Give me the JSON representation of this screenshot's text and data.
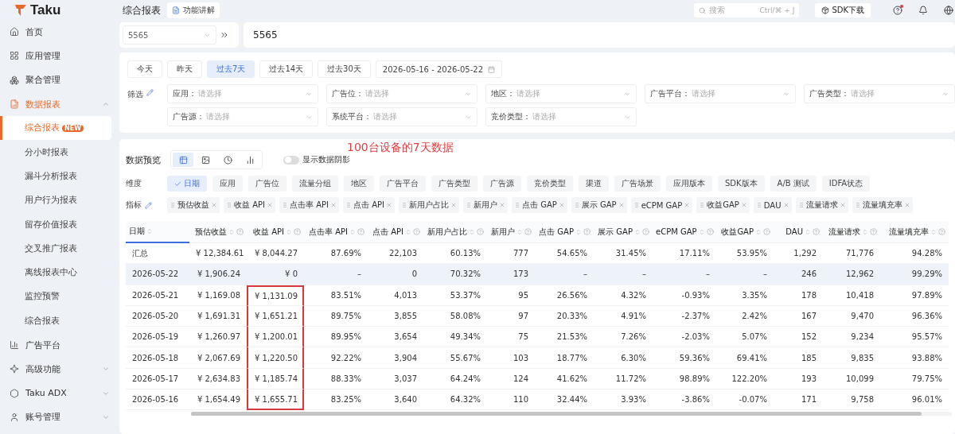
{
  "sidebar": {
    "logo": "Taku",
    "items": [
      {
        "label": "首页",
        "kind": "link",
        "selected": false
      },
      {
        "label": "应用管理",
        "kind": "link",
        "selected": false
      },
      {
        "label": "聚合管理",
        "kind": "link",
        "selected": false
      },
      {
        "label": "数据报表",
        "kind": "group",
        "selected": true,
        "expanded": true,
        "children": [
          {
            "label": "综合报表",
            "badge": "NEW",
            "selected": true
          },
          {
            "label": "分小时报表",
            "selected": false
          },
          {
            "label": "漏斗分析报表",
            "selected": false
          },
          {
            "label": "用户行为报表",
            "selected": false
          },
          {
            "label": "留存价值报表",
            "selected": false
          },
          {
            "label": "交叉推广报表",
            "selected": false
          },
          {
            "label": "离线报表中心",
            "selected": false
          },
          {
            "label": "监控预警",
            "selected": false
          },
          {
            "label": "综合报表",
            "selected": false
          }
        ]
      },
      {
        "label": "广告平台",
        "kind": "link",
        "selected": false
      },
      {
        "label": "高级功能",
        "kind": "group",
        "selected": false,
        "expanded": false
      },
      {
        "label": "Taku ADX",
        "kind": "group",
        "selected": false,
        "expanded": false
      },
      {
        "label": "账号管理",
        "kind": "group",
        "selected": false,
        "expanded": false
      }
    ]
  },
  "topbar": {
    "title": "综合报表",
    "guide_button": "功能讲解",
    "search": {
      "placeholder": "搜索",
      "shortcut": "Ctrl/⌘ + J"
    },
    "sdk_button": "SDK下载",
    "help_unread": true
  },
  "app_select": {
    "value": "5565"
  },
  "app_name": "5565",
  "date_ranges": [
    {
      "label": "今天",
      "selected": false
    },
    {
      "label": "昨天",
      "selected": false
    },
    {
      "label": "过去7天",
      "selected": true
    },
    {
      "label": "过去14天",
      "selected": false
    },
    {
      "label": "过去30天",
      "selected": false
    }
  ],
  "date_picker": "2026-05-16 - 2026-05-22",
  "filters": {
    "label": "筛选",
    "rows": [
      [
        {
          "label": "应用：",
          "placeholder": "请选择"
        },
        {
          "label": "广告位：",
          "placeholder": "请选择"
        },
        {
          "label": "地区：",
          "placeholder": "请选择"
        },
        {
          "label": "广告平台：",
          "placeholder": "请选择"
        },
        {
          "label": "广告类型：",
          "placeholder": "请选择"
        }
      ],
      [
        {
          "label": "广告源：",
          "placeholder": "请选择"
        },
        {
          "label": "系统平台：",
          "placeholder": "请选择"
        },
        {
          "label": "竞价类型：",
          "placeholder": "请选择"
        }
      ]
    ]
  },
  "preview": {
    "title": "数据预览",
    "views": [
      {
        "selected": true
      },
      {
        "selected": false
      },
      {
        "selected": false
      },
      {
        "selected": false
      }
    ],
    "shadow_toggle": {
      "label": "显示数据阴影",
      "on": false
    },
    "annotation": "100台设备的7天数据"
  },
  "dimensions": {
    "label": "维度",
    "items": [
      {
        "label": "日期",
        "selected": true
      },
      {
        "label": "应用",
        "selected": false
      },
      {
        "label": "广告位",
        "selected": false
      },
      {
        "label": "流量分组",
        "selected": false
      },
      {
        "label": "地区",
        "selected": false
      },
      {
        "label": "广告平台",
        "selected": false
      },
      {
        "label": "广告类型",
        "selected": false
      },
      {
        "label": "广告源",
        "selected": false
      },
      {
        "label": "竞价类型",
        "selected": false
      },
      {
        "label": "渠道",
        "selected": false
      },
      {
        "label": "广告场景",
        "selected": false
      },
      {
        "label": "应用版本",
        "selected": false
      },
      {
        "label": "SDK版本",
        "selected": false
      },
      {
        "label": "A/B 测试",
        "selected": false
      },
      {
        "label": "IDFA状态",
        "selected": false
      }
    ]
  },
  "metrics": {
    "label": "指标",
    "items": [
      "预估收益",
      "收益 API",
      "点击率 API",
      "点击 API",
      "新用户占比",
      "新用户",
      "点击 GAP",
      "展示 GAP",
      "eCPM GAP",
      "收益GAP",
      "DAU",
      "流量请求",
      "流量填充率"
    ]
  },
  "table": {
    "columns": [
      {
        "label": "日期",
        "help": false,
        "boxed": false
      },
      {
        "label": "预估收益",
        "help": true,
        "boxed": false
      },
      {
        "label": "收益 API",
        "help": true,
        "boxed": true
      },
      {
        "label": "点击率 API",
        "help": true,
        "boxed": false
      },
      {
        "label": "点击 API",
        "help": true,
        "boxed": false
      },
      {
        "label": "新用户占比",
        "help": true,
        "boxed": false
      },
      {
        "label": "新用户",
        "help": true,
        "boxed": false
      },
      {
        "label": "点击 GAP",
        "help": true,
        "boxed": false
      },
      {
        "label": "展示 GAP",
        "help": true,
        "boxed": false
      },
      {
        "label": "eCPM GAP",
        "help": true,
        "boxed": false
      },
      {
        "label": "收益GAP",
        "help": true,
        "boxed": false
      },
      {
        "label": "DAU",
        "help": true,
        "boxed": false
      },
      {
        "label": "流量请求",
        "help": true,
        "boxed": false
      },
      {
        "label": "流量填充率",
        "help": true,
        "boxed": false
      }
    ],
    "rows": [
      {
        "highlighted": false,
        "boxed": false,
        "cells": [
          "汇总",
          "¥ 12,384.61",
          "¥ 8,044.27",
          "87.69%",
          "22,103",
          "60.13%",
          "777",
          "54.65%",
          "31.45%",
          "17.11%",
          "53.95%",
          "1,292",
          "71,776",
          "94.28%"
        ]
      },
      {
        "highlighted": true,
        "boxed": false,
        "cells": [
          "2026-05-22",
          "¥ 1,906.24",
          "¥ 0",
          "–",
          "0",
          "70.32%",
          "173",
          "–",
          "–",
          "–",
          "–",
          "246",
          "12,962",
          "99.29%"
        ]
      },
      {
        "highlighted": false,
        "boxed": true,
        "cells": [
          "2026-05-21",
          "¥ 1,169.08",
          "¥ 1,131.09",
          "83.51%",
          "4,013",
          "53.37%",
          "95",
          "26.56%",
          "4.32%",
          "-0.93%",
          "3.35%",
          "178",
          "10,418",
          "97.89%"
        ]
      },
      {
        "highlighted": false,
        "boxed": true,
        "cells": [
          "2026-05-20",
          "¥ 1,691.31",
          "¥ 1,651.21",
          "89.75%",
          "3,855",
          "58.08%",
          "97",
          "20.33%",
          "4.91%",
          "-2.37%",
          "2.42%",
          "167",
          "9,470",
          "96.36%"
        ]
      },
      {
        "highlighted": false,
        "boxed": true,
        "cells": [
          "2026-05-19",
          "¥ 1,260.97",
          "¥ 1,200.01",
          "89.95%",
          "3,654",
          "49.34%",
          "75",
          "21.53%",
          "7.26%",
          "-2.03%",
          "5.07%",
          "152",
          "9,234",
          "95.57%"
        ]
      },
      {
        "highlighted": false,
        "boxed": true,
        "cells": [
          "2026-05-18",
          "¥ 2,067.69",
          "¥ 1,220.50",
          "92.22%",
          "3,904",
          "55.67%",
          "103",
          "18.77%",
          "6.30%",
          "59.36%",
          "69.41%",
          "185",
          "9,835",
          "93.88%"
        ]
      },
      {
        "highlighted": false,
        "boxed": true,
        "cells": [
          "2026-05-17",
          "¥ 2,634.83",
          "¥ 1,185.74",
          "88.33%",
          "3,037",
          "64.24%",
          "124",
          "41.62%",
          "11.72%",
          "98.89%",
          "122.20%",
          "193",
          "10,099",
          "79.75%"
        ]
      },
      {
        "highlighted": false,
        "boxed": true,
        "cells": [
          "2026-05-16",
          "¥ 1,654.49",
          "¥ 1,655.71",
          "83.25%",
          "3,640",
          "64.32%",
          "110",
          "32.44%",
          "3.93%",
          "-3.86%",
          "-0.07%",
          "171",
          "9,758",
          "96.01%"
        ]
      }
    ]
  }
}
